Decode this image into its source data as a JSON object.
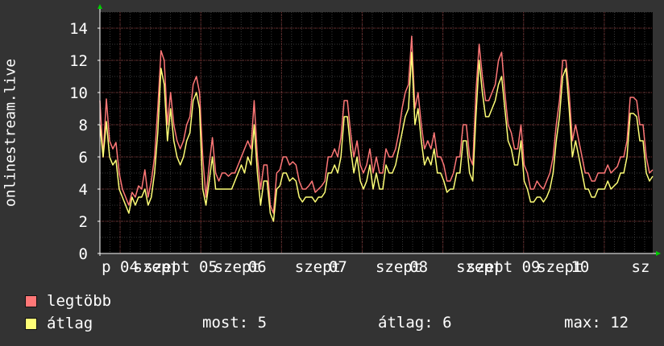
{
  "chart_data": {
    "type": "line",
    "ylabel": "onlinestream.live",
    "ylim": [
      0,
      15
    ],
    "yticks": [
      0,
      2,
      4,
      6,
      8,
      10,
      12,
      14
    ],
    "xticks": [
      {
        "label": "p 04",
        "x": 0.25
      },
      {
        "label": "szept",
        "x": 0.7
      },
      {
        "label": "szept 05",
        "x": 1.0
      },
      {
        "label": "szept",
        "x": 1.7
      },
      {
        "label": "06",
        "x": 1.95
      },
      {
        "label": "szept",
        "x": 2.7
      },
      {
        "label": "07",
        "x": 2.95
      },
      {
        "label": "szept",
        "x": 3.7
      },
      {
        "label": "08",
        "x": 3.95
      },
      {
        "label": "szept",
        "x": 4.7
      },
      {
        "label": "szept 09",
        "x": 5.0
      },
      {
        "label": "szept",
        "x": 5.7
      },
      {
        "label": "10",
        "x": 5.95
      },
      {
        "label": "sz",
        "x": 6.7
      }
    ],
    "grid": true,
    "legend_position": "bottom-left",
    "x_range": [
      0,
      6.85
    ],
    "series": [
      {
        "name": "legtöbb",
        "color": "#ff7777",
        "values": [
          9.5,
          6,
          9.6,
          7,
          6.5,
          6.9,
          5,
          4,
          3.5,
          3,
          3.8,
          3.5,
          4.2,
          4,
          5.2,
          3.5,
          4.5,
          6,
          9,
          12.6,
          12,
          8,
          10,
          8,
          7,
          6.5,
          7,
          8,
          8.5,
          10.5,
          11,
          10,
          6,
          3.5,
          5.5,
          7.2,
          5,
          4.5,
          5,
          5,
          4.8,
          5,
          5,
          5.5,
          6,
          6.5,
          7,
          6.5,
          9.5,
          6,
          4,
          5.5,
          5.5,
          3,
          2.5,
          5,
          5.2,
          6,
          6,
          5.5,
          5.7,
          5.5,
          4.5,
          4,
          4,
          4.2,
          4.5,
          3.8,
          4,
          4.2,
          4.5,
          6,
          6,
          6.5,
          6,
          7.2,
          9.5,
          9.5,
          7.5,
          6,
          7,
          5.5,
          5,
          5.5,
          6.5,
          5,
          6,
          5,
          5,
          6.5,
          6,
          6,
          6.5,
          7.5,
          9,
          10,
          10.5,
          13.5,
          9,
          10,
          8,
          6.5,
          7,
          6.5,
          7.5,
          6,
          6,
          5.5,
          4.5,
          4.5,
          5,
          6,
          6,
          8,
          8,
          6,
          5.5,
          10,
          13,
          11,
          9.5,
          9.5,
          10,
          10.5,
          12,
          12.5,
          10,
          8,
          7.5,
          6.5,
          6.5,
          8,
          5.5,
          5,
          4,
          4,
          4.5,
          4.2,
          4,
          4.5,
          5,
          6,
          8,
          9.5,
          12,
          12,
          10,
          7,
          8,
          7,
          6,
          5,
          5,
          4.5,
          4.5,
          5,
          5,
          5,
          5.5,
          5,
          5.2,
          5.4,
          6,
          6,
          7,
          9.7,
          9.7,
          9.5,
          8,
          8,
          6,
          5,
          5.2
        ]
      },
      {
        "name": "átlag",
        "color": "#ffff77",
        "values": [
          8,
          6,
          8.2,
          6,
          5.5,
          5.8,
          4,
          3.5,
          3,
          2.5,
          3.5,
          3,
          3.5,
          3.5,
          4,
          3,
          3.5,
          5,
          7.5,
          11.5,
          10.5,
          7,
          9,
          7,
          6,
          5.5,
          6,
          7,
          7.5,
          9.5,
          10,
          9,
          4,
          3,
          4.5,
          6,
          4,
          4,
          4,
          4,
          4,
          4,
          4.5,
          5,
          5.5,
          5,
          6,
          5.5,
          8,
          5,
          3,
          4.5,
          4.5,
          2.5,
          2,
          4,
          4.2,
          5,
          5,
          4.5,
          4.7,
          4.5,
          3.5,
          3.2,
          3.5,
          3.5,
          3.5,
          3.2,
          3.5,
          3.5,
          3.8,
          5,
          5,
          5.5,
          5,
          6,
          8.5,
          8.5,
          6.5,
          5,
          6,
          4.5,
          4,
          4.5,
          5.5,
          4,
          5,
          4,
          4,
          5.5,
          5,
          5,
          5.5,
          6.5,
          7.5,
          8.5,
          9,
          12.5,
          8,
          9,
          7,
          5.5,
          6,
          5.5,
          6.5,
          5,
          5,
          4.5,
          3.8,
          4,
          4,
          5,
          5,
          7,
          7,
          5,
          4.5,
          8.5,
          12,
          10,
          8.5,
          8.5,
          9,
          9.5,
          10.5,
          11,
          9,
          7,
          6.5,
          5.5,
          5.5,
          7,
          4.5,
          4,
          3.2,
          3.2,
          3.5,
          3.5,
          3.2,
          3.5,
          4,
          5,
          7,
          8.5,
          11,
          11.5,
          9,
          6,
          7,
          6,
          5,
          4,
          4,
          3.5,
          3.5,
          4,
          4,
          4,
          4.5,
          4,
          4.2,
          4.4,
          5,
          5,
          6,
          8.7,
          8.7,
          8.5,
          7,
          7,
          5,
          4.5,
          4.8
        ]
      }
    ]
  },
  "legend": {
    "max_label": "legtöbb",
    "avg_label": "átlag",
    "max_color": "#ff7777",
    "avg_color": "#ffff77"
  },
  "stats": {
    "current": "most: 5",
    "average": "átlag: 6",
    "max": "max: 12"
  }
}
